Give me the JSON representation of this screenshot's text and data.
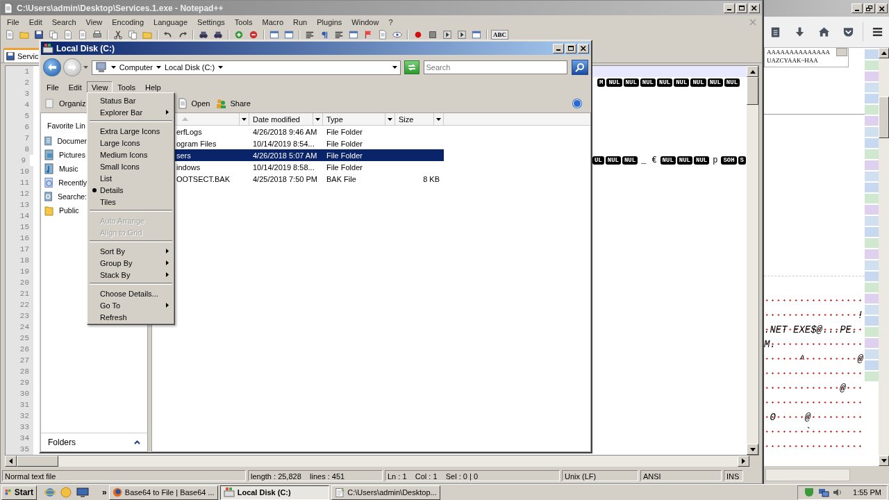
{
  "notepad": {
    "title": "C:\\Users\\admin\\Desktop\\Services.1.exe - Notepad++",
    "menu": [
      "File",
      "Edit",
      "Search",
      "View",
      "Encoding",
      "Language",
      "Settings",
      "Tools",
      "Macro",
      "Run",
      "Plugins",
      "Window",
      "?"
    ],
    "spell_button": "ABC",
    "tab": "Servic",
    "lines": [
      {
        "number": "1",
        "current": true
      },
      {
        "number": "2",
        "current": false,
        "tokens": [
          {
            "kind": "ctrl",
            "text": "M"
          },
          {
            "kind": "ctrl",
            "text": "NUL"
          },
          {
            "kind": "ctrl",
            "text": "NUL"
          },
          {
            "kind": "ctrl",
            "text": "NUL"
          },
          {
            "kind": "ctrl",
            "text": "NUL"
          },
          {
            "kind": "ctrl",
            "text": "NUL"
          },
          {
            "kind": "ctrl",
            "text": "NUL"
          },
          {
            "kind": "ctrl",
            "text": "NUL"
          },
          {
            "kind": "ctrl",
            "text": "NUL"
          }
        ]
      },
      {
        "number": "3",
        "current": false
      },
      {
        "number": "4",
        "current": false
      },
      {
        "number": "5",
        "current": false
      },
      {
        "number": "6",
        "current": false
      },
      {
        "number": "7",
        "current": false
      },
      {
        "number": "8",
        "current": false
      },
      {
        "number": "9",
        "current": false,
        "tokens": [
          {
            "kind": "ctrl",
            "text": "UL"
          },
          {
            "kind": "ctrl",
            "text": "NUL"
          },
          {
            "kind": "ctrl",
            "text": "NUL"
          },
          {
            "kind": "text",
            "text": "_"
          },
          {
            "kind": "text",
            "text": "€"
          },
          {
            "kind": "ctrl",
            "text": "NUL"
          },
          {
            "kind": "ctrl",
            "text": "NUL"
          },
          {
            "kind": "ctrl",
            "text": "NUL"
          },
          {
            "kind": "text",
            "text": "p"
          },
          {
            "kind": "ctrl",
            "text": "SOH"
          },
          {
            "kind": "ctrl",
            "text": "S"
          }
        ]
      },
      {
        "number": "10",
        "current": false
      },
      {
        "number": "11",
        "current": false
      },
      {
        "number": "12",
        "current": false
      },
      {
        "number": "13",
        "current": false
      },
      {
        "number": "14",
        "current": false
      },
      {
        "number": "15",
        "current": false
      },
      {
        "number": "16",
        "current": false
      },
      {
        "number": "17",
        "current": false
      },
      {
        "number": "18",
        "current": false
      },
      {
        "number": "19",
        "current": false
      },
      {
        "number": "20",
        "current": false
      },
      {
        "number": "21",
        "current": false
      },
      {
        "number": "22",
        "current": false
      },
      {
        "number": "23",
        "current": false
      },
      {
        "number": "24",
        "current": false
      },
      {
        "number": "25",
        "current": false
      },
      {
        "number": "26",
        "current": false
      },
      {
        "number": "27",
        "current": false
      },
      {
        "number": "28",
        "current": false
      },
      {
        "number": "29",
        "current": false
      },
      {
        "number": "30",
        "current": false
      },
      {
        "number": "31",
        "current": false
      },
      {
        "number": "32",
        "current": false
      },
      {
        "number": "33",
        "current": false
      },
      {
        "number": "34",
        "current": false
      },
      {
        "number": "35",
        "current": false
      }
    ],
    "status": [
      "Normal text file",
      "length : 25,828    lines : 451",
      "Ln : 1    Col : 1    Sel : 0 | 0",
      "Unix (LF)",
      "ANSI",
      "INS"
    ]
  },
  "explorer": {
    "title": "Local Disk (C:)",
    "breadcrumb": [
      "Computer",
      "Local Disk (C:)"
    ],
    "search_placeholder": "Search",
    "menu": [
      {
        "label": "File",
        "selected": false
      },
      {
        "label": "Edit",
        "selected": false
      },
      {
        "label": "View",
        "selected": true
      },
      {
        "label": "Tools",
        "selected": false
      },
      {
        "label": "Help",
        "selected": false
      }
    ],
    "toolbar": [
      "Organiz",
      "Open",
      "Share"
    ],
    "favorites_title": "Favorite Lin",
    "favorites": [
      {
        "label": "Documer",
        "kind": "documents"
      },
      {
        "label": "Pictures",
        "kind": "pictures"
      },
      {
        "label": "Music",
        "kind": "music"
      },
      {
        "label": "Recently",
        "kind": "recent"
      },
      {
        "label": "Searche:",
        "kind": "searches"
      },
      {
        "label": "Public",
        "kind": "folder"
      }
    ],
    "folders_label": "Folders",
    "columns": [
      "Date modified",
      "Type",
      "Size"
    ],
    "rows": [
      {
        "name": "erfLogs",
        "date": "4/26/2018 9:46 AM",
        "type": "File Folder",
        "selected": false
      },
      {
        "name": "ogram Files",
        "date": "10/14/2019 8:54...",
        "type": "File Folder",
        "selected": false
      },
      {
        "name": "sers",
        "date": "4/26/2018 5:07 AM",
        "type": "File Folder",
        "selected": true
      },
      {
        "name": "indows",
        "date": "10/14/2019 8:58...",
        "type": "File Folder",
        "selected": false
      },
      {
        "name": "OOTSECT.BAK",
        "date": "4/25/2018 7:50 PM",
        "type": "BAK File",
        "size": "8 KB",
        "selected": false
      }
    ]
  },
  "view_menu": [
    [
      {
        "label": "Status Bar",
        "submenu": false,
        "checked": false,
        "disabled": false
      },
      {
        "label": "Explorer Bar",
        "submenu": true,
        "checked": false,
        "disabled": false
      }
    ],
    [
      {
        "label": "Extra Large Icons",
        "submenu": false,
        "checked": false,
        "disabled": false
      },
      {
        "label": "Large Icons",
        "submenu": false,
        "checked": false,
        "disabled": false
      },
      {
        "label": "Medium Icons",
        "submenu": false,
        "checked": false,
        "disabled": false
      },
      {
        "label": "Small Icons",
        "submenu": false,
        "checked": false,
        "disabled": false
      },
      {
        "label": "List",
        "submenu": false,
        "checked": false,
        "disabled": false
      },
      {
        "label": "Details",
        "submenu": false,
        "checked": true,
        "disabled": false
      },
      {
        "label": "Tiles",
        "submenu": false,
        "checked": false,
        "disabled": false
      }
    ],
    [
      {
        "label": "Auto Arrange",
        "submenu": false,
        "checked": false,
        "disabled": true
      },
      {
        "label": "Align to Grid",
        "submenu": false,
        "checked": false,
        "disabled": true
      }
    ],
    [
      {
        "label": "Sort By",
        "submenu": true,
        "checked": false,
        "disabled": false
      },
      {
        "label": "Group By",
        "submenu": true,
        "checked": false,
        "disabled": false
      },
      {
        "label": "Stack By",
        "submenu": true,
        "checked": false,
        "disabled": false
      }
    ],
    [
      {
        "label": "Choose Details...",
        "submenu": false,
        "checked": false,
        "disabled": false
      },
      {
        "label": "Go To",
        "submenu": true,
        "checked": false,
        "disabled": false
      },
      {
        "label": "Refresh",
        "submenu": false,
        "checked": false,
        "disabled": false
      }
    ]
  ],
  "browser": {
    "textbox_lines": [
      "AAAAAAAAAAAAAA",
      "UAZCYAAK~HAA"
    ],
    "rows": [
      {
        "kind": "spaces"
      },
      {
        "kind": "text",
        "text": "                !"
      },
      {
        "kind": "text",
        "text": ".NET EXE$@...PE."
      },
      {
        "kind": "text",
        "text": "M."
      },
      {
        "kind": "text",
        "text": "      ^         @"
      },
      {
        "kind": "spaces"
      },
      {
        "kind": "text",
        "text": "             @"
      },
      {
        "kind": "spaces"
      },
      {
        "kind": "text",
        "text": " O     @"
      },
      {
        "kind": "text",
        "text": "       `"
      },
      {
        "kind": "spaces"
      }
    ]
  },
  "taskbar": {
    "start": "Start",
    "more": "»",
    "tasks": [
      {
        "label": "Base64 to File | Base64 ...",
        "kind": "globe",
        "selected": false
      },
      {
        "label": "Local Disk (C:)",
        "kind": "explorer",
        "selected": true
      },
      {
        "label": "C:\\Users\\admin\\Desktop...",
        "kind": "notepad",
        "selected": false
      }
    ],
    "clock": "1:55 PM"
  }
}
